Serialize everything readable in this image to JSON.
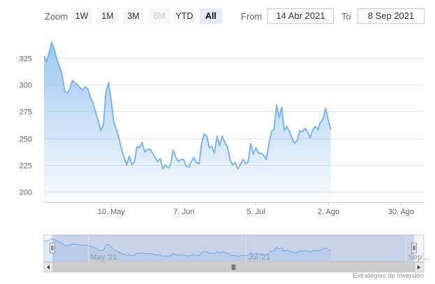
{
  "range_selector": {
    "zoom_label": "Zoom",
    "buttons": [
      {
        "label": "1W",
        "state": "normal"
      },
      {
        "label": "1M",
        "state": "normal"
      },
      {
        "label": "3M",
        "state": "normal"
      },
      {
        "label": "6M",
        "state": "disabled"
      },
      {
        "label": "YTD",
        "state": "normal"
      },
      {
        "label": "All",
        "state": "active"
      }
    ],
    "from_label": "From",
    "from_value": "14 Abr 2021",
    "to_label": "To",
    "to_value": "8 Sep 2021"
  },
  "chart_data": {
    "type": "area",
    "x_start": "2021-04-14",
    "x_end": "2021-09-08",
    "ylim": [
      190,
      350
    ],
    "yticks": [
      200,
      225,
      250,
      275,
      300,
      325
    ],
    "xticks": [
      {
        "date": "2021-05-10",
        "label": "10. May"
      },
      {
        "date": "2021-06-07",
        "label": "7. Jun"
      },
      {
        "date": "2021-07-05",
        "label": "5. Jul"
      },
      {
        "date": "2021-08-02",
        "label": "2. Ago"
      },
      {
        "date": "2021-08-30",
        "label": "30. Ago"
      }
    ],
    "grid": true,
    "legend": "none",
    "series": [
      {
        "color": "#7cb5ec",
        "points": [
          [
            "2021-04-14",
            327
          ],
          [
            "2021-04-15",
            322
          ],
          [
            "2021-04-16",
            330
          ],
          [
            "2021-04-17",
            340
          ],
          [
            "2021-04-18",
            333
          ],
          [
            "2021-04-19",
            324
          ],
          [
            "2021-04-20",
            317
          ],
          [
            "2021-04-21",
            310
          ],
          [
            "2021-04-22",
            294
          ],
          [
            "2021-04-23",
            292
          ],
          [
            "2021-04-24",
            296
          ],
          [
            "2021-04-25",
            304
          ],
          [
            "2021-04-26",
            302
          ],
          [
            "2021-04-27",
            300
          ],
          [
            "2021-04-28",
            297
          ],
          [
            "2021-04-29",
            295
          ],
          [
            "2021-04-30",
            298
          ],
          [
            "2021-05-01",
            296
          ],
          [
            "2021-05-02",
            288
          ],
          [
            "2021-05-03",
            283
          ],
          [
            "2021-05-04",
            274
          ],
          [
            "2021-05-05",
            266
          ],
          [
            "2021-05-06",
            257
          ],
          [
            "2021-05-07",
            263
          ],
          [
            "2021-05-08",
            294
          ],
          [
            "2021-05-09",
            302
          ],
          [
            "2021-05-10",
            285
          ],
          [
            "2021-05-11",
            265
          ],
          [
            "2021-05-12",
            258
          ],
          [
            "2021-05-13",
            250
          ],
          [
            "2021-05-14",
            240
          ],
          [
            "2021-05-15",
            232
          ],
          [
            "2021-05-16",
            225
          ],
          [
            "2021-05-17",
            233
          ],
          [
            "2021-05-18",
            225
          ],
          [
            "2021-05-19",
            228
          ],
          [
            "2021-05-20",
            242
          ],
          [
            "2021-05-21",
            241
          ],
          [
            "2021-05-22",
            246
          ],
          [
            "2021-05-23",
            237
          ],
          [
            "2021-05-24",
            239
          ],
          [
            "2021-05-25",
            240
          ],
          [
            "2021-05-26",
            236
          ],
          [
            "2021-05-27",
            232
          ],
          [
            "2021-05-28",
            228
          ],
          [
            "2021-05-29",
            231
          ],
          [
            "2021-05-30",
            221
          ],
          [
            "2021-05-31",
            225
          ],
          [
            "2021-06-01",
            222
          ],
          [
            "2021-06-02",
            225
          ],
          [
            "2021-06-03",
            239
          ],
          [
            "2021-06-04",
            232
          ],
          [
            "2021-06-05",
            228
          ],
          [
            "2021-06-06",
            230
          ],
          [
            "2021-06-07",
            230
          ],
          [
            "2021-06-08",
            224
          ],
          [
            "2021-06-09",
            223
          ],
          [
            "2021-06-10",
            228
          ],
          [
            "2021-06-11",
            232
          ],
          [
            "2021-06-12",
            227
          ],
          [
            "2021-06-13",
            226
          ],
          [
            "2021-06-14",
            245
          ],
          [
            "2021-06-15",
            254
          ],
          [
            "2021-06-16",
            252
          ],
          [
            "2021-06-17",
            241
          ],
          [
            "2021-06-18",
            242
          ],
          [
            "2021-06-19",
            236
          ],
          [
            "2021-06-20",
            252
          ],
          [
            "2021-06-21",
            243
          ],
          [
            "2021-06-22",
            252
          ],
          [
            "2021-06-23",
            246
          ],
          [
            "2021-06-24",
            242
          ],
          [
            "2021-06-25",
            230
          ],
          [
            "2021-06-26",
            225
          ],
          [
            "2021-06-27",
            227
          ],
          [
            "2021-06-28",
            221
          ],
          [
            "2021-06-29",
            225
          ],
          [
            "2021-06-30",
            230
          ],
          [
            "2021-07-01",
            226
          ],
          [
            "2021-07-02",
            228
          ],
          [
            "2021-07-03",
            245
          ],
          [
            "2021-07-04",
            235
          ],
          [
            "2021-07-05",
            241
          ],
          [
            "2021-07-06",
            236
          ],
          [
            "2021-07-07",
            236
          ],
          [
            "2021-07-08",
            234
          ],
          [
            "2021-07-09",
            230
          ],
          [
            "2021-07-10",
            244
          ],
          [
            "2021-07-11",
            256
          ],
          [
            "2021-07-12",
            258
          ],
          [
            "2021-07-13",
            281
          ],
          [
            "2021-07-14",
            269
          ],
          [
            "2021-07-15",
            279
          ],
          [
            "2021-07-16",
            257
          ],
          [
            "2021-07-17",
            261
          ],
          [
            "2021-07-18",
            256
          ],
          [
            "2021-07-19",
            250
          ],
          [
            "2021-07-20",
            245
          ],
          [
            "2021-07-21",
            248
          ],
          [
            "2021-07-22",
            257
          ],
          [
            "2021-07-23",
            256
          ],
          [
            "2021-07-24",
            259
          ],
          [
            "2021-07-25",
            256
          ],
          [
            "2021-07-26",
            250
          ],
          [
            "2021-07-27",
            258
          ],
          [
            "2021-07-28",
            261
          ],
          [
            "2021-07-29",
            258
          ],
          [
            "2021-07-30",
            265
          ],
          [
            "2021-07-31",
            268
          ],
          [
            "2021-08-01",
            278
          ],
          [
            "2021-08-02",
            267
          ],
          [
            "2021-08-03",
            258
          ]
        ]
      }
    ],
    "navigator": {
      "xticks": [
        {
          "date": "2021-05-01",
          "label": "May '21"
        },
        {
          "date": "2021-07-01",
          "label": "Jul '21"
        },
        {
          "date": "2021-09-01",
          "label": "Sep ..."
        }
      ]
    }
  },
  "credits": "Estrategias de Inversión"
}
